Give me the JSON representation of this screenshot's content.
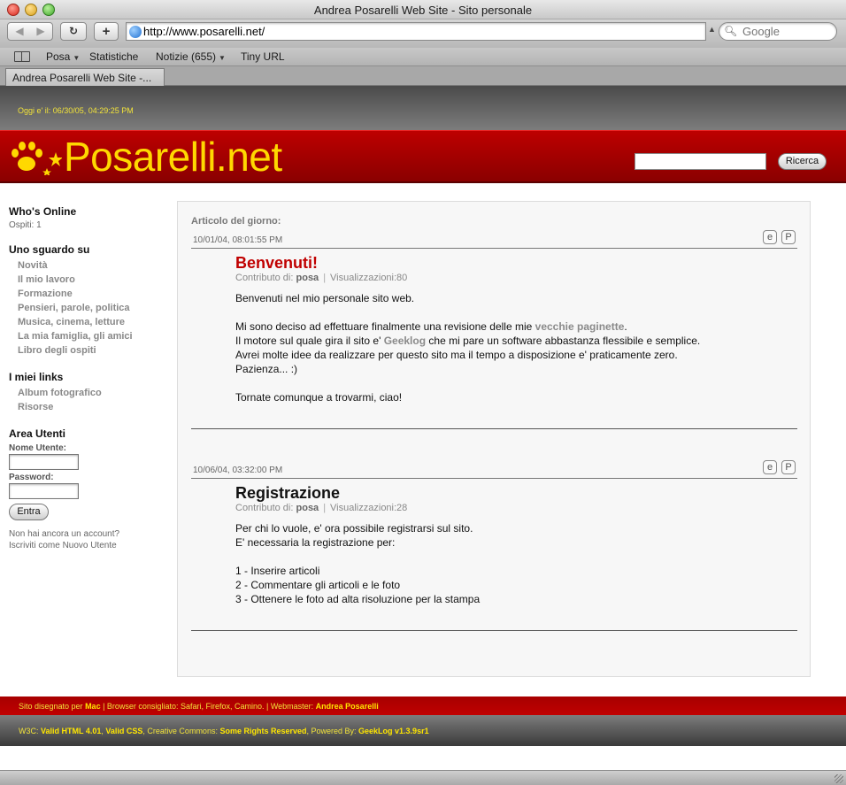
{
  "window": {
    "title": "Andrea Posarelli Web Site - Sito personale"
  },
  "toolbar": {
    "back_icon": "◀",
    "forward_icon": "▶",
    "reload_icon": "↻",
    "add_icon": "+",
    "url": "http://www.posarelli.net/",
    "search_placeholder": "Google"
  },
  "bookmarks": [
    {
      "label": "Posa",
      "has_menu": true
    },
    {
      "label": "Statistiche",
      "has_menu": false
    },
    {
      "label": "Notizie (655)",
      "has_menu": true
    },
    {
      "label": "Tiny URL",
      "has_menu": false
    }
  ],
  "tab": {
    "label": "Andrea Posarelli Web Site -..."
  },
  "site": {
    "date_line": "Oggi e' il: 06/30/05, 04:29:25 PM",
    "logo": "Posarelli.net",
    "search_button": "Ricerca",
    "colors": {
      "red": "#b00000",
      "yellow": "#ffd800",
      "title_red": "#c00000"
    }
  },
  "sidebar": {
    "online": {
      "title": "Who's Online",
      "guests": "Ospiti: 1"
    },
    "uno_sguardo": {
      "title": "Uno sguardo su",
      "items": [
        "Novità",
        "Il mio lavoro",
        "Formazione",
        "Pensieri, parole, politica",
        "Musica, cinema, letture",
        "La mia famiglia, gli amici",
        "Libro degli ospiti"
      ]
    },
    "links": {
      "title": "I miei links",
      "items": [
        "Album fotografico",
        "Risorse"
      ]
    },
    "area_utenti": {
      "title": "Area Utenti",
      "username_label": "Nome Utente:",
      "password_label": "Password:",
      "login_button": "Entra",
      "note_line1": "Non hai ancora un account?",
      "note_line2_prefix": "Iscriviti come ",
      "note_link": "Nuovo Utente"
    }
  },
  "main": {
    "featured_label": "Articolo del giorno:",
    "stories": [
      {
        "date": "10/01/04, 08:01:55 PM",
        "title": "Benvenuti!",
        "byline_prefix": "Contributo di:",
        "author": "posa",
        "views": "Visualizzazioni:80",
        "p1": "Benvenuti nel mio personale sito web.",
        "p2_prefix": "Mi sono deciso ad effettuare finalmente una revisione delle mie ",
        "p2_link": "vecchie paginette",
        "p2_suffix": ".",
        "p3_prefix": "Il motore sul quale gira il sito e' ",
        "p3_link": "Geeklog",
        "p3_suffix": " che mi pare un software abbastanza flessibile e semplice.",
        "p4": "Avrei molte idee da realizzare per questo sito ma il tempo a disposizione e' praticamente zero.",
        "p5": "Pazienza... :)",
        "p6": "Tornate comunque a trovarmi, ciao!"
      },
      {
        "date": "10/06/04, 03:32:00 PM",
        "title": "Registrazione",
        "byline_prefix": "Contributo di:",
        "author": "posa",
        "views": "Visualizzazioni:28",
        "l1": "Per chi lo vuole, e' ora possibile registrarsi sul sito.",
        "l2": "E' necessaria la registrazione per:",
        "l3": "1 - Inserire articoli",
        "l4": "2 - Commentare gli articoli e le foto",
        "l5": "3 - Ottenere le foto ad alta risoluzione per la stampa"
      }
    ],
    "email_icon_glyph": "e",
    "print_icon_glyph": "P"
  },
  "footer": {
    "line1_a": "Sito disegnato per ",
    "line1_mac": "Mac",
    "line1_b": " | Browser consigliato: Safari, Firefox, Camino. | Webmaster: ",
    "line1_webmaster": "Andrea Posarelli",
    "line2_a": "W3C: ",
    "line2_html": "Valid HTML 4.01",
    "line2_b": ", ",
    "line2_css": "Valid CSS",
    "line2_c": ", Creative Commons: ",
    "line2_cc": "Some Rights Reserved",
    "line2_d": ", Powered By: ",
    "line2_gl": "GeekLog v1.3.9sr1"
  }
}
